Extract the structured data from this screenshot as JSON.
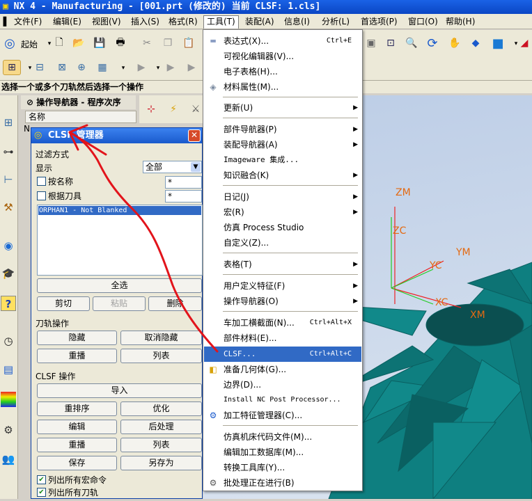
{
  "window": {
    "title": "NX 4 - Manufacturing - [001.prt (修改的)      当前 CLSF: 1.cls]"
  },
  "menubar": {
    "items": [
      "文件(F)",
      "编辑(E)",
      "视图(V)",
      "插入(S)",
      "格式(R)",
      "工具(T)",
      "装配(A)",
      "信息(I)",
      "分析(L)",
      "首选项(P)",
      "窗口(O)",
      "帮助(H)"
    ]
  },
  "toolbar": {
    "start_label": "起始"
  },
  "prompt": "选择一个或多个刀轨然后选择一个操作",
  "navigator": {
    "header": "操作导航器 - 程序次序",
    "column": "名称",
    "row_prefix": "N"
  },
  "dialog": {
    "title": "CLSF 管理器",
    "filter_label": "过滤方式",
    "display_label": "显示",
    "display_value": "全部",
    "by_name_label": "按名称",
    "by_name_value": "*",
    "by_tool_label": "根据刀具",
    "by_tool_value": "*",
    "list_items": [
      "ORPHAN1 - Not Blanked"
    ],
    "btn_select_all": "全选",
    "btn_cut": "剪切",
    "btn_paste": "粘贴",
    "btn_delete": "删除",
    "path_ops_label": "刀轨操作",
    "btn_hide": "隐藏",
    "btn_unhide": "取消隐藏",
    "btn_replay1": "重播",
    "btn_list1": "列表",
    "clsf_ops_label": "CLSF 操作",
    "btn_import": "导入",
    "btn_reorder": "重排序",
    "btn_optimize": "优化",
    "btn_edit": "编辑",
    "btn_postprocess": "后处理",
    "btn_replay2": "重播",
    "btn_list2": "列表",
    "btn_save": "保存",
    "btn_saveas": "另存为",
    "chk_macros": "列出所有宏命令",
    "chk_paths": "列出所有刀轨"
  },
  "tools_menu": {
    "items": [
      {
        "label": "表达式(X)...",
        "shortcut": "Ctrl+E",
        "icon": "expression-icon"
      },
      {
        "label": "可视化编辑器(V)...",
        "shortcut": ""
      },
      {
        "label": "电子表格(H)...",
        "shortcut": ""
      },
      {
        "label": "材料属性(M)...",
        "shortcut": "",
        "icon": "material-icon"
      },
      {
        "label": "更新(U)",
        "submenu": true
      },
      {
        "label": "部件导航器(P)",
        "submenu": true
      },
      {
        "label": "装配导航器(A)",
        "submenu": true
      },
      {
        "label": "Imageware 集成...",
        "shortcut": ""
      },
      {
        "label": "知识融合(K)",
        "submenu": true
      },
      {
        "label": "日记(J)",
        "submenu": true
      },
      {
        "label": "宏(R)",
        "submenu": true
      },
      {
        "label": "仿真 Process Studio",
        "shortcut": ""
      },
      {
        "label": "自定义(Z)...",
        "shortcut": ""
      },
      {
        "label": "表格(T)",
        "submenu": true
      },
      {
        "label": "用户定义特征(F)",
        "submenu": true
      },
      {
        "label": "操作导航器(O)",
        "submenu": true
      },
      {
        "label": "车加工横截面(N)...",
        "shortcut": "Ctrl+Alt+X"
      },
      {
        "label": "部件材料(E)...",
        "shortcut": ""
      },
      {
        "label": "CLSF...",
        "shortcut": "Ctrl+Alt+C"
      },
      {
        "label": "准备几何体(G)...",
        "shortcut": "",
        "icon": "prepare-geometry-icon"
      },
      {
        "label": "边界(D)...",
        "shortcut": ""
      },
      {
        "label": "Install NC Post Processor...",
        "shortcut": ""
      },
      {
        "label": "加工特征管理器(C)...",
        "shortcut": "",
        "icon": "feature-manager-icon"
      },
      {
        "label": "仿真机床代码文件(M)...",
        "shortcut": ""
      },
      {
        "label": "编辑加工数据库(M)...",
        "shortcut": ""
      },
      {
        "label": "转换工具库(Y)...",
        "shortcut": ""
      },
      {
        "label": "批处理正在进行(B)",
        "shortcut": "",
        "icon": "batch-icon"
      }
    ]
  },
  "viewport": {
    "axes": [
      "ZM",
      "ZC",
      "YM",
      "YC",
      "XC",
      "XM"
    ],
    "axis_color": "#e46a12",
    "part_color": "#0e7f80"
  },
  "colors": {
    "title_bar": "#0a46c4",
    "menu_highlight": "#316ac5",
    "annotation_red": "#e2141b"
  }
}
